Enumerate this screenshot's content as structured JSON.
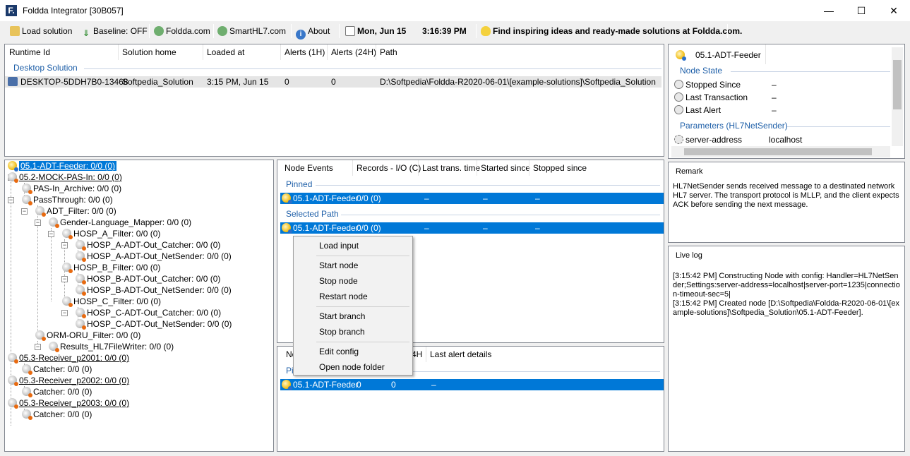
{
  "window": {
    "title": "Foldda Integrator [30B057]",
    "app_icon": "F.",
    "minimize": "—",
    "maximize": "☐",
    "close": "✕"
  },
  "toolbar": {
    "load_solution": "Load solution",
    "baseline": "Baseline: OFF",
    "foldda": "Foldda.com",
    "smarthl7": "SmartHL7.com",
    "about": "About",
    "date": "Mon, Jun 15",
    "time": "3:16:39 PM",
    "tip": "Find inspiring ideas and ready-made solutions at Foldda.com."
  },
  "runtime": {
    "columns": [
      "Runtime Id",
      "Solution home",
      "Loaded at",
      "Alerts (1H)",
      "Alerts (24H)",
      "Path"
    ],
    "group": "Desktop Solution",
    "row": {
      "id": "DESKTOP-5DDH7B0-13468",
      "home": "Softpedia_Solution",
      "loaded": "3:15 PM, Jun 15",
      "alerts1h": "0",
      "alerts24h": "0",
      "path": "D:\\Softpedia\\Foldda-R2020-06-01\\[example-solutions]\\Softpedia_Solution"
    }
  },
  "tree": [
    "05.1-ADT-Feeder: 0/0 (0)",
    "05.2-MOCK-PAS-In: 0/0 (0)",
    "PAS-In_Archive: 0/0 (0)",
    "PassThrough: 0/0 (0)",
    "ADT_Filter: 0/0 (0)",
    "Gender-Language_Mapper: 0/0 (0)",
    "HOSP_A_Filter: 0/0 (0)",
    "HOSP_A-ADT-Out_Catcher: 0/0 (0)",
    "HOSP_A-ADT-Out_NetSender: 0/0 (0)",
    "HOSP_B_Filter: 0/0 (0)",
    "HOSP_B-ADT-Out_Catcher: 0/0 (0)",
    "HOSP_B-ADT-Out_NetSender: 0/0 (0)",
    "HOSP_C_Filter: 0/0 (0)",
    "HOSP_C-ADT-Out_Catcher: 0/0 (0)",
    "HOSP_C-ADT-Out_NetSender: 0/0 (0)",
    "ORM-ORU_Filter: 0/0 (0)",
    "Results_HL7FileWriter: 0/0 (0)",
    "05.3-Receiver_p2001: 0/0 (0)",
    "Catcher: 0/0 (0)",
    "05.3-Receiver_p2002: 0/0 (0)",
    "Catcher: 0/0 (0)",
    "05.3-Receiver_p2003: 0/0 (0)",
    "Catcher: 0/0 (0)"
  ],
  "events": {
    "columns": [
      "Node Events",
      "Records - I/O (C)",
      "Last trans. time",
      "Started since",
      "Stopped since"
    ],
    "pinned": "Pinned",
    "selected_path": "Selected Path",
    "row_name": "05.1-ADT-Feeder",
    "row_records": "0/0 (0)",
    "dash": "–"
  },
  "alerts": {
    "col_no": "No",
    "col_24h": "4H",
    "col_details": "Last alert details",
    "pinned": "Pi",
    "row_name": "05.1-ADT-Feeder",
    "v1": "0",
    "v2": "0",
    "dash": "–"
  },
  "context_menu": {
    "load_input": "Load input",
    "start_node": "Start node",
    "stop_node": "Stop node",
    "restart_node": "Restart node",
    "start_branch": "Start branch",
    "stop_branch": "Stop branch",
    "edit_config": "Edit config",
    "open_folder": "Open node folder"
  },
  "props": {
    "title": "05.1-ADT-Feeder",
    "node_state": "Node State",
    "stopped_since": "Stopped Since",
    "last_transaction": "Last Transaction",
    "last_alert": "Last Alert",
    "dash": "–",
    "parameters": "Parameters (HL7NetSender)",
    "server_address": "server-address",
    "server_value": "localhost"
  },
  "remark": {
    "title": "Remark",
    "text": "HL7NetSender sends received message to a destinated network HL7 server. The transport protocol is MLLP, and the client expects ACK before sending the next message."
  },
  "livelog": {
    "title": "Live log",
    "text": "[3:15:42 PM] Constructing Node with config: Handler=HL7NetSender;Settings:server-address=localhost|server-port=1235|connection-timeout-sec=5|\n[3:15:42 PM] Created node [D:\\Softpedia\\Foldda-R2020-06-01\\[example-solutions]\\Softpedia_Solution\\05.1-ADT-Feeder]."
  },
  "colors": {
    "accent": "#0078d7",
    "group": "#1e5fa8"
  }
}
